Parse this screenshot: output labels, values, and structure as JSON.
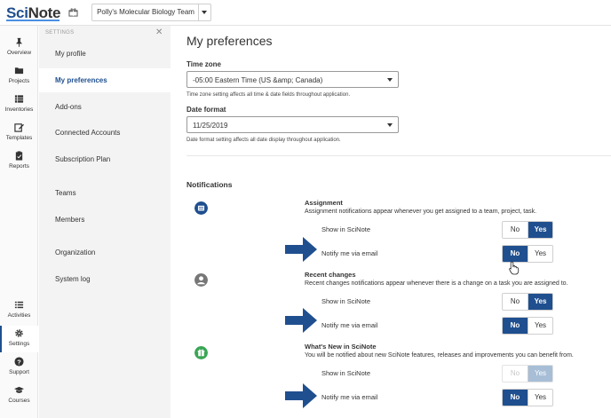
{
  "topbar": {
    "logo_sci": "Sci",
    "logo_note": "Note",
    "team_name": "Polly's Molecular Biology Team"
  },
  "leftnav": {
    "items": [
      {
        "label": "Overview",
        "icon": "pin-icon"
      },
      {
        "label": "Projects",
        "icon": "folder-icon"
      },
      {
        "label": "Inventories",
        "icon": "inventory-icon"
      },
      {
        "label": "Templates",
        "icon": "edit-icon"
      },
      {
        "label": "Reports",
        "icon": "clipboard-icon"
      },
      {
        "label": "Activities",
        "icon": "list-icon"
      },
      {
        "label": "Settings",
        "icon": "gear-icon"
      },
      {
        "label": "Support",
        "icon": "question-icon"
      },
      {
        "label": "Courses",
        "icon": "graduation-cap-icon"
      }
    ]
  },
  "settings": {
    "heading": "SETTINGS",
    "close": "✕",
    "items": [
      {
        "label": "My profile"
      },
      {
        "label": "My preferences"
      },
      {
        "label": "Add-ons"
      },
      {
        "label": "Connected Accounts"
      },
      {
        "label": "Subscription Plan"
      },
      {
        "label": "Teams"
      },
      {
        "label": "Members"
      },
      {
        "label": "Organization"
      },
      {
        "label": "System log"
      }
    ]
  },
  "main": {
    "title": "My preferences",
    "timezone": {
      "label": "Time zone",
      "value": "-05:00 Eastern Time (US &amp; Canada)",
      "hint": "Time zone setting affects all time & date fields throughout application."
    },
    "date_format": {
      "label": "Date format",
      "value": "11/25/2019",
      "hint": "Date format setting affects all date display throughout application."
    },
    "notifications": {
      "title": "Notifications",
      "show_label": "Show in SciNote",
      "email_label": "Notify me via email",
      "no": "No",
      "yes": "Yes",
      "groups": [
        {
          "title": "Assignment",
          "desc": "Assignment notifications appear whenever you get assigned to a team, project, task.",
          "show": "yes",
          "email": "no",
          "icon_color": "#1f4f8f"
        },
        {
          "title": "Recent changes",
          "desc": "Recent changes notifications appear whenever there is a change on a task you are assigned to.",
          "show": "yes",
          "email": "no",
          "icon_color": "#777777"
        },
        {
          "title": "What's New in SciNote",
          "desc": "You will be notified about new SciNote features, releases and improvements you can benefit from.",
          "show": "yes",
          "email": "no",
          "icon_color": "#3aa655",
          "show_disabled": true
        }
      ]
    }
  },
  "colors": {
    "primary": "#1f4f8f",
    "arrow": "#1f4f8f"
  }
}
